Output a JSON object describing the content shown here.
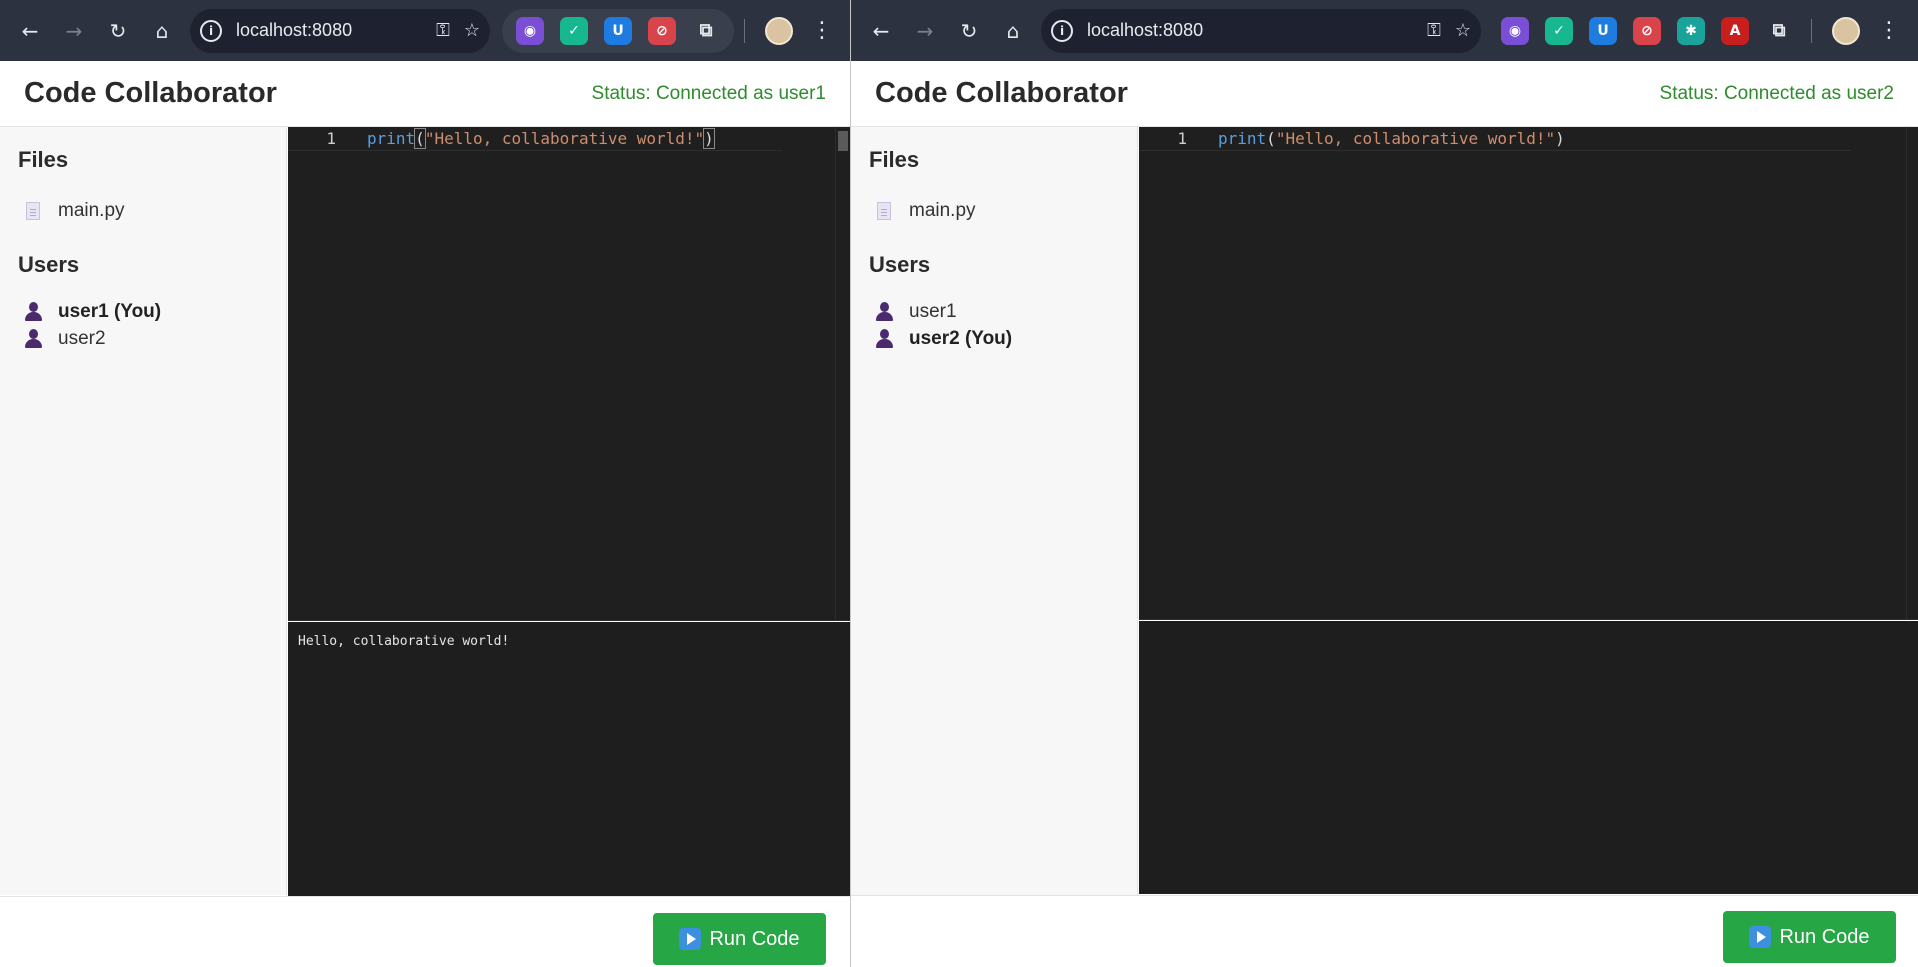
{
  "windows": [
    {
      "url": "localhost:8080",
      "icons": {
        "back": "back-arrow-icon",
        "forward": "forward-arrow-icon",
        "reload": "reload-icon",
        "home": "home-icon",
        "site_info": "info-icon",
        "password": "key-icon",
        "bookmark": "star-icon",
        "menu": "kebab-menu-icon"
      },
      "app_title": "Code Collaborator",
      "status": "Status: Connected as user1",
      "files_heading": "Files",
      "files": [
        "main.py"
      ],
      "users_heading": "Users",
      "users": [
        {
          "label": "user1 (You)",
          "self": true
        },
        {
          "label": "user2",
          "self": false
        }
      ],
      "editor": {
        "line_number": "1",
        "code": {
          "fn": "print",
          "open": "(",
          "str": "\"Hello, collaborative world!\"",
          "close": ")"
        }
      },
      "output": "Hello, collaborative world!",
      "run_label": "Run Code"
    },
    {
      "url": "localhost:8080",
      "icons": {
        "back": "back-arrow-icon",
        "forward": "forward-arrow-icon",
        "reload": "reload-icon",
        "home": "home-icon",
        "site_info": "info-icon",
        "password": "key-icon",
        "bookmark": "star-icon",
        "menu": "kebab-menu-icon"
      },
      "app_title": "Code Collaborator",
      "status": "Status: Connected as user2",
      "files_heading": "Files",
      "files": [
        "main.py"
      ],
      "users_heading": "Users",
      "users": [
        {
          "label": "user1",
          "self": false
        },
        {
          "label": "user2 (You)",
          "self": true
        }
      ],
      "editor": {
        "line_number": "1",
        "code": {
          "fn": "print",
          "open": "(",
          "str": "\"Hello, collaborative world!\"",
          "close": ")"
        }
      },
      "output": "",
      "run_label": "Run Code"
    }
  ],
  "colors": {
    "toolbar_bg": "#2d3240",
    "status_green": "#2e8b2e",
    "run_button": "#27a645",
    "editor_bg": "#1f1f1f",
    "user_icon": "#4b2b6e"
  }
}
